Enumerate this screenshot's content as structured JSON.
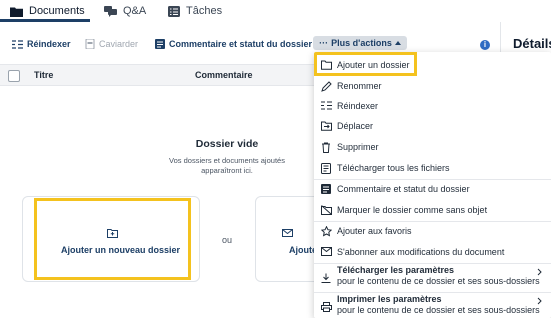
{
  "tabs": [
    {
      "label": "Documents",
      "icon": "folder-icon",
      "active": true
    },
    {
      "label": "Q&A",
      "icon": "chat-icon",
      "active": false
    },
    {
      "label": "Tâches",
      "icon": "tasks-icon",
      "active": false
    }
  ],
  "details": {
    "title": "Détails"
  },
  "toolbar": {
    "reindex": "Réindexer",
    "redact": "Caviarder",
    "comment_status": "Commentaire et statut du dossier",
    "more_actions": "Plus d'actions"
  },
  "table": {
    "col_title": "Titre",
    "col_comment": "Commentaire"
  },
  "empty": {
    "title": "Dossier vide",
    "subtitle": "Vos dossiers et documents ajoutés apparaîtront ici.",
    "card_left_label": "Ajouter un nouveau dossier",
    "or": "ou",
    "card_right_label": "Ajoute"
  },
  "menu": {
    "items": [
      {
        "label": "Ajouter un dossier",
        "icon": "folder-outline-icon"
      },
      {
        "label": "Renommer",
        "icon": "pencil-icon"
      },
      {
        "label": "Réindexer",
        "icon": "reindex-icon"
      },
      {
        "label": "Déplacer",
        "icon": "move-folder-icon"
      },
      {
        "label": "Supprimer",
        "icon": "trash-icon"
      },
      {
        "label": "Télécharger tous les fichiers",
        "icon": "download-files-icon"
      },
      {
        "label": "Commentaire et statut du dossier",
        "icon": "comment-status-icon"
      },
      {
        "label": "Marquer le dossier comme sans objet",
        "icon": "hide-icon"
      },
      {
        "label": "Ajouter aux favoris",
        "icon": "star-icon"
      },
      {
        "label": "S'abonner aux modifications du document",
        "icon": "mail-icon"
      }
    ],
    "download_settings": {
      "title": "Télécharger les paramètres",
      "subtitle": "pour le contenu de ce dossier et ses sous-dossiers"
    },
    "print_settings": {
      "title": "Imprimer les paramètres",
      "subtitle": "pour le contenu de ce dossier et ses sous-dossiers"
    }
  },
  "colors": {
    "accent": "#1d3f66",
    "highlight": "#f4c21e",
    "info": "#2f6cc3"
  }
}
